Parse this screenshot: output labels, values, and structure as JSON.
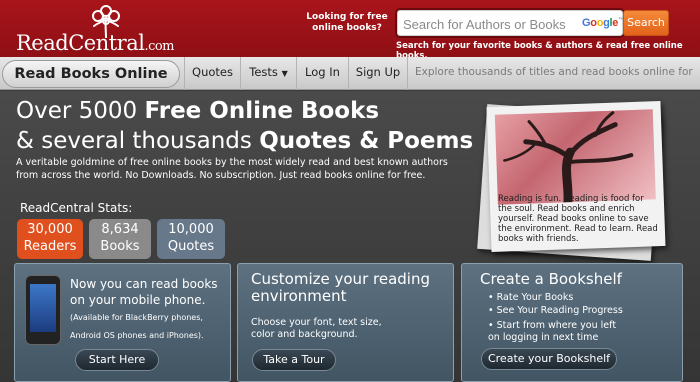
{
  "header": {
    "logo_text": "ReadCentral",
    "logo_domain": ".com",
    "looking_text": "Looking for free online books?",
    "search_placeholder": "Search for Authors or Books",
    "google_label": "Google",
    "search_button": "Search",
    "tagline": "Search for your favorite books & authors & read free online books."
  },
  "nav": {
    "main_label": "Read Books Online",
    "items": [
      {
        "label": "Quotes"
      },
      {
        "label": "Tests"
      },
      {
        "label": "Log In"
      },
      {
        "label": "Sign Up"
      }
    ],
    "tagline": "Explore thousands of titles and read books online for free."
  },
  "hero": {
    "line1_prefix": "Over 5000 ",
    "line1_bold": "Free Online Books",
    "line2_prefix": "& several thousands ",
    "line2_bold": "Quotes & Poems",
    "description": "A veritable goldmine of free online books by the most widely read and best known authors from across the world. No Downloads. No subscription. Just read books online for free.",
    "stats_label": "ReadCentral Stats:",
    "stats": [
      {
        "value": "30,000",
        "label": "Readers",
        "color": "#e0501f"
      },
      {
        "value": "8,634",
        "label": "Books",
        "color": "#8a8a8a"
      },
      {
        "value": "10,000",
        "label": "Quotes",
        "color": "#66788a"
      }
    ],
    "photo_caption": "Reading is fun. Reading is food for the soul. Read books and enrich yourself. Read books online to save the environment. Read to learn. Read books with friends."
  },
  "cards": [
    {
      "title": "Now you can read books on your mobile phone.",
      "small": "(Available for BlackBerry phones, Android OS phones and iPhones).",
      "button": "Start Here"
    },
    {
      "title": "Customize your reading environment",
      "body": "Choose your font, text size, color and background.",
      "button": "Take a Tour"
    },
    {
      "title": "Create a Bookshelf",
      "features": [
        "Rate Your Books",
        "See Your Reading Progress",
        "Start from where you left on logging in next time"
      ],
      "button": "Create your Bookshelf"
    }
  ],
  "colors": {
    "brand_red": "#9d1318",
    "accent_orange": "#e8692a"
  }
}
